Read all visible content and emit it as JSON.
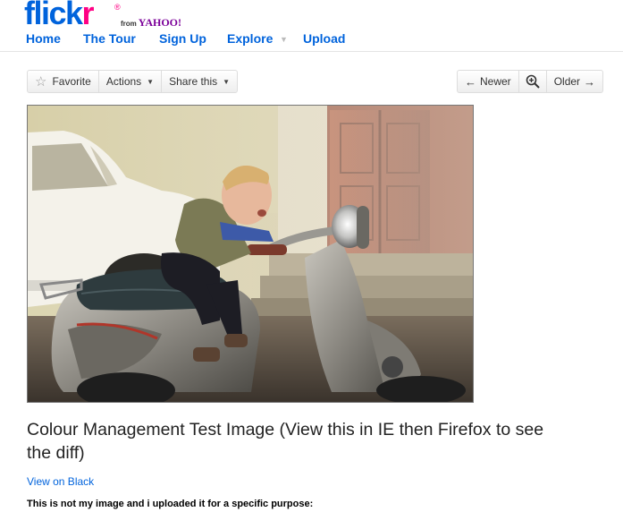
{
  "logo": {
    "text_blue": "flick",
    "text_pink": "r",
    "reg_mark": "®",
    "from": "from",
    "yahoo": "YAHOO!"
  },
  "nav": {
    "home": "Home",
    "tour": "The Tour",
    "signup": "Sign Up",
    "explore": "Explore",
    "explore_caret": "▼",
    "upload": "Upload"
  },
  "toolbar": {
    "favorite": "Favorite",
    "actions": "Actions",
    "share": "Share this",
    "newer": "Newer",
    "older": "Older"
  },
  "photo": {
    "title": "Colour Management Test Image (View this in IE then Firefox to see the diff)"
  },
  "links": {
    "view_on_black": "View on Black"
  },
  "description": "This is not my image and i uploaded it for a specific purpose:",
  "colors": {
    "flickr_blue": "#0063dc",
    "flickr_pink": "#ff0084",
    "yahoo_purple": "#7b0099"
  }
}
